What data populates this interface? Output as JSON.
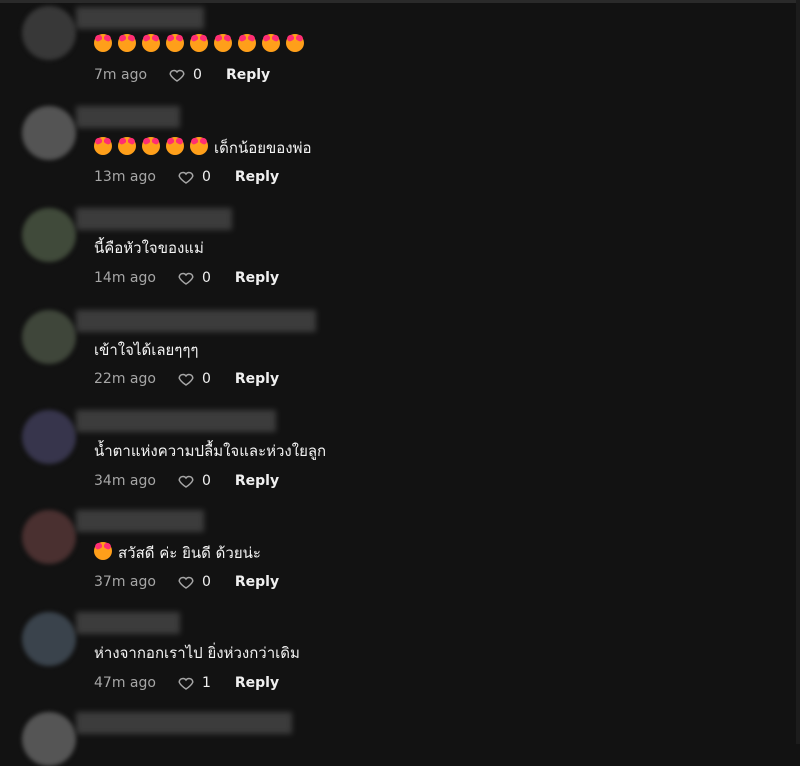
{
  "comments": [
    {
      "avatar": "#383838",
      "text": "🥰🥰🥰🥰🥰🥰🥰🥰🥰",
      "time": "7m ago",
      "likes": "0",
      "reply": "Reply"
    },
    {
      "avatar": "#545454",
      "text": "🥰🥰🥰🥰🥰 เด็กน้อยของพ่อ",
      "time": "13m ago",
      "likes": "0",
      "reply": "Reply"
    },
    {
      "avatar": "#404a3a",
      "text": "นี้คือหัวใจของแม่",
      "time": "14m ago",
      "likes": "0",
      "reply": "Reply"
    },
    {
      "avatar": "#3f463a",
      "text": "เข้าใจได้เลยๆๆๆ",
      "time": "22m ago",
      "likes": "0",
      "reply": "Reply"
    },
    {
      "avatar": "#37354c",
      "text": "น้ำตาแห่งความปลื้มใจและห่วงใยลูก",
      "time": "34m ago",
      "likes": "0",
      "reply": "Reply"
    },
    {
      "avatar": "#4a3030",
      "text": "🥰 สวัสดี ค่ะ ยินดี ด้วยน่ะ",
      "time": "37m ago",
      "likes": "0",
      "reply": "Reply"
    },
    {
      "avatar": "#3a434c",
      "text": "ห่างจากอกเราไป ยิ่งห่วงกว่าเดิม",
      "time": "47m ago",
      "likes": "1",
      "reply": "Reply"
    },
    {
      "avatar": "#555555",
      "text": "",
      "time": "",
      "likes": "",
      "reply": ""
    }
  ]
}
